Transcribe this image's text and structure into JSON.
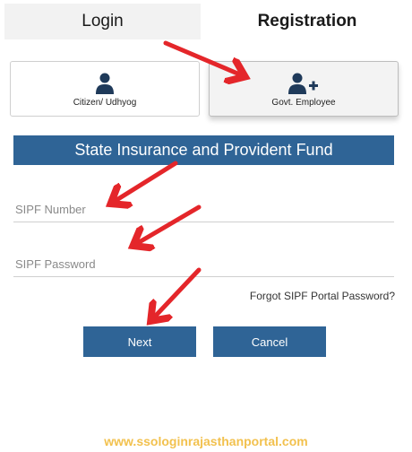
{
  "tabs": {
    "login": "Login",
    "registration": "Registration"
  },
  "cards": {
    "citizen": "Citizen/ Udhyog",
    "govt": "Govt. Employee"
  },
  "banner": "State Insurance and Provident Fund",
  "fields": {
    "sipf_number": "SIPF Number",
    "sipf_password": "SIPF Password"
  },
  "forgot": "Forgot SIPF Portal Password?",
  "buttons": {
    "next": "Next",
    "cancel": "Cancel"
  },
  "footer": "www.ssologinrajasthanportal.com",
  "colors": {
    "primary": "#2f6496",
    "arrow": "#e4262a",
    "footer": "#f2c14e"
  },
  "icons": {
    "citizen": "user-icon",
    "govt": "user-plus-icon"
  }
}
